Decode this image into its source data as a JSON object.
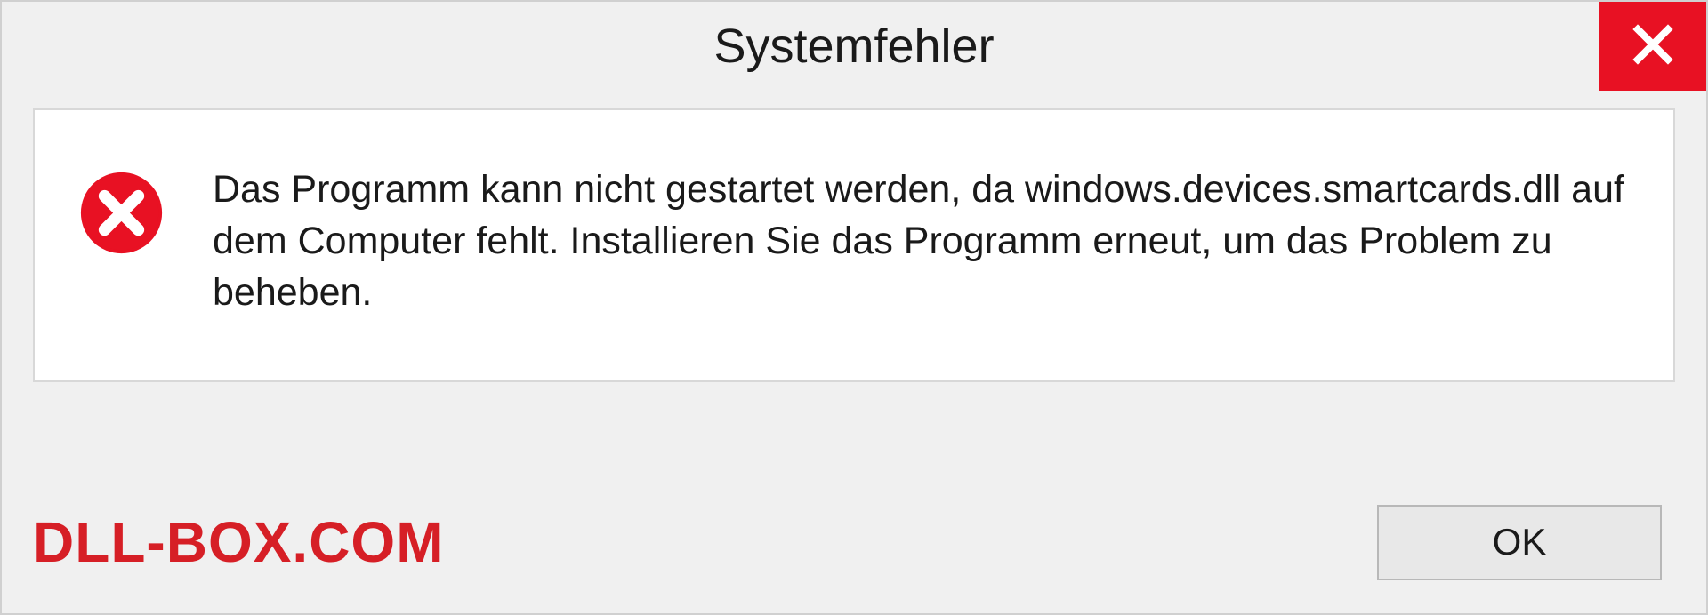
{
  "dialog": {
    "title": "Systemfehler",
    "message": "Das Programm kann nicht gestartet werden, da windows.devices.smartcards.dll auf dem Computer fehlt. Installieren Sie das Programm erneut, um das Problem zu beheben.",
    "ok_label": "OK"
  },
  "watermark": "DLL-BOX.COM"
}
